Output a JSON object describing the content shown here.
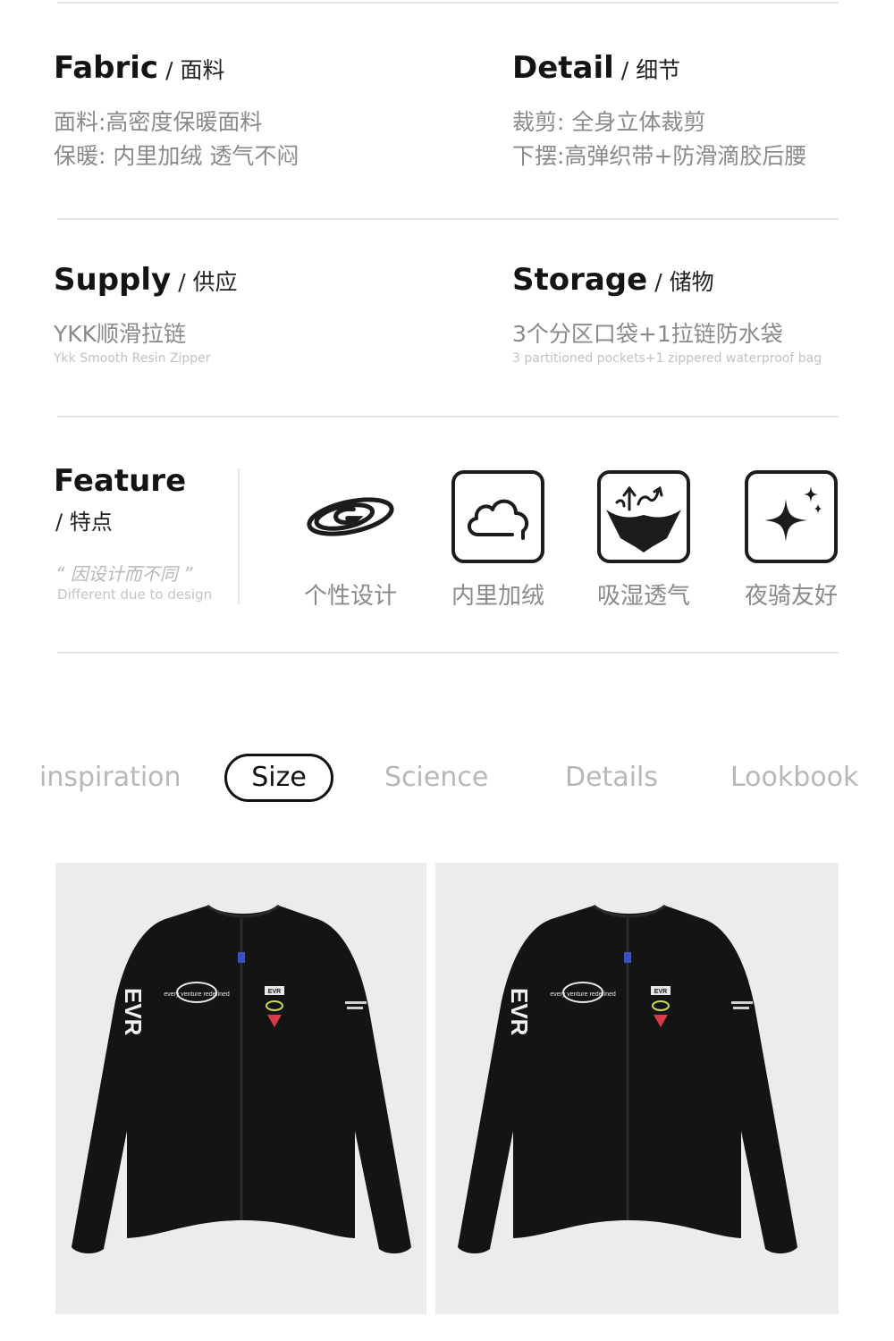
{
  "specs": {
    "fabric": {
      "title": "Fabric",
      "subtitle": "/ 面料",
      "lines": [
        "面料:高密度保暖面料",
        "保暖: 内里加绒 透气不闷"
      ]
    },
    "detail": {
      "title": "Detail",
      "subtitle": "/ 细节",
      "lines": [
        "裁剪: 全身立体裁剪",
        "下摆:高弹织带+防滑滴胶后腰"
      ]
    },
    "supply": {
      "title": "Supply",
      "subtitle": "/ 供应",
      "line": "YKK顺滑拉链",
      "en": "Ykk Smooth Resin Zipper"
    },
    "storage": {
      "title": "Storage",
      "subtitle": "/ 储物",
      "line": "3个分区口袋+1拉链防水袋",
      "en": "3 partitioned pockets+1 zippered waterproof bag"
    }
  },
  "feature": {
    "title": "Feature",
    "subtitle": "/ 特点",
    "quote": "“ 因设计而不同 ”",
    "en": "Different due to design",
    "items": [
      {
        "label": "个性设计",
        "icon": "brand-logo-icon"
      },
      {
        "label": "内里加绒",
        "icon": "cloud-icon"
      },
      {
        "label": "吸湿透气",
        "icon": "breathable-fabric-icon"
      },
      {
        "label": "夜骑友好",
        "icon": "sparkle-icon"
      }
    ]
  },
  "tabs": [
    "inspiration",
    "Size",
    "Science",
    "Details",
    "Lookbook"
  ],
  "active_tab": "Size",
  "colors": {
    "text_dark": "#141414",
    "text_muted": "#8a8a8a",
    "text_light": "#c2c2c2",
    "divider": "#e4e4e4",
    "photo_bg": "#ececec",
    "jacket": "#141414"
  },
  "photos": [
    {
      "alt_name": "jacket-photo-front",
      "logo_text": "EVR",
      "sleeve_text": "EVR",
      "badge_text": "every venture redefined"
    },
    {
      "alt_name": "jacket-photo-second",
      "logo_text": "EVR",
      "sleeve_text": "EVR",
      "badge_text": "every venture redefined"
    }
  ]
}
